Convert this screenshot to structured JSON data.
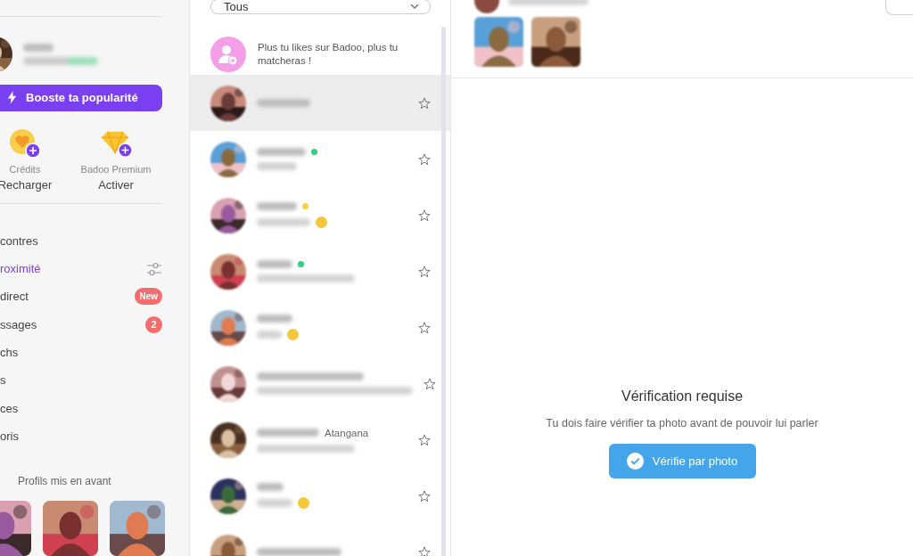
{
  "sidebar": {
    "boost_button": {
      "label": "Booste ta popularité"
    },
    "wallet": [
      {
        "kind": "credits",
        "title": "Crédits",
        "action": "Recharger"
      },
      {
        "kind": "premium",
        "title": "Badoo Premium",
        "action": "Activer"
      }
    ],
    "menu": [
      {
        "label": "contres",
        "selected": false,
        "filter": false
      },
      {
        "label": "roximité",
        "selected": true,
        "filter": true
      },
      {
        "label": "direct",
        "selected": false,
        "filter": false,
        "badge": "New"
      },
      {
        "label": "ssages",
        "selected": false,
        "filter": false,
        "badge": "2"
      },
      {
        "label": "chs",
        "selected": false,
        "filter": false
      },
      {
        "label": "s",
        "selected": false,
        "filter": false
      },
      {
        "label": "ces",
        "selected": false,
        "filter": false
      },
      {
        "label": "oris",
        "selected": false,
        "filter": false
      }
    ],
    "featured": {
      "title": "Profils mis en avant"
    }
  },
  "conversations": {
    "filter": {
      "value": "Tous"
    },
    "promo": {
      "text": "Plus tu likes sur Badoo, plus tu matcheras !"
    },
    "rows": [
      {
        "selected": true,
        "emoji": false
      },
      {
        "selected": false,
        "color": "#2fd27a",
        "emoji": false
      },
      {
        "selected": false,
        "color": "#f7d34a",
        "emoji": true
      },
      {
        "selected": false,
        "color": "#2fd27a",
        "emoji": false
      },
      {
        "selected": false,
        "emoji": true
      },
      {
        "selected": false,
        "emoji": false
      },
      {
        "selected": false,
        "emoji": false,
        "name_tail": "Atangana"
      },
      {
        "selected": false,
        "emoji": true
      },
      {
        "selected": false,
        "emoji": false
      }
    ]
  },
  "chat": {
    "notice": {
      "title": "Vérification requise",
      "text": "Tu dois faire vérifier ta photo avant de pouvoir lui parler",
      "button": "Vérifie par photo"
    }
  }
}
